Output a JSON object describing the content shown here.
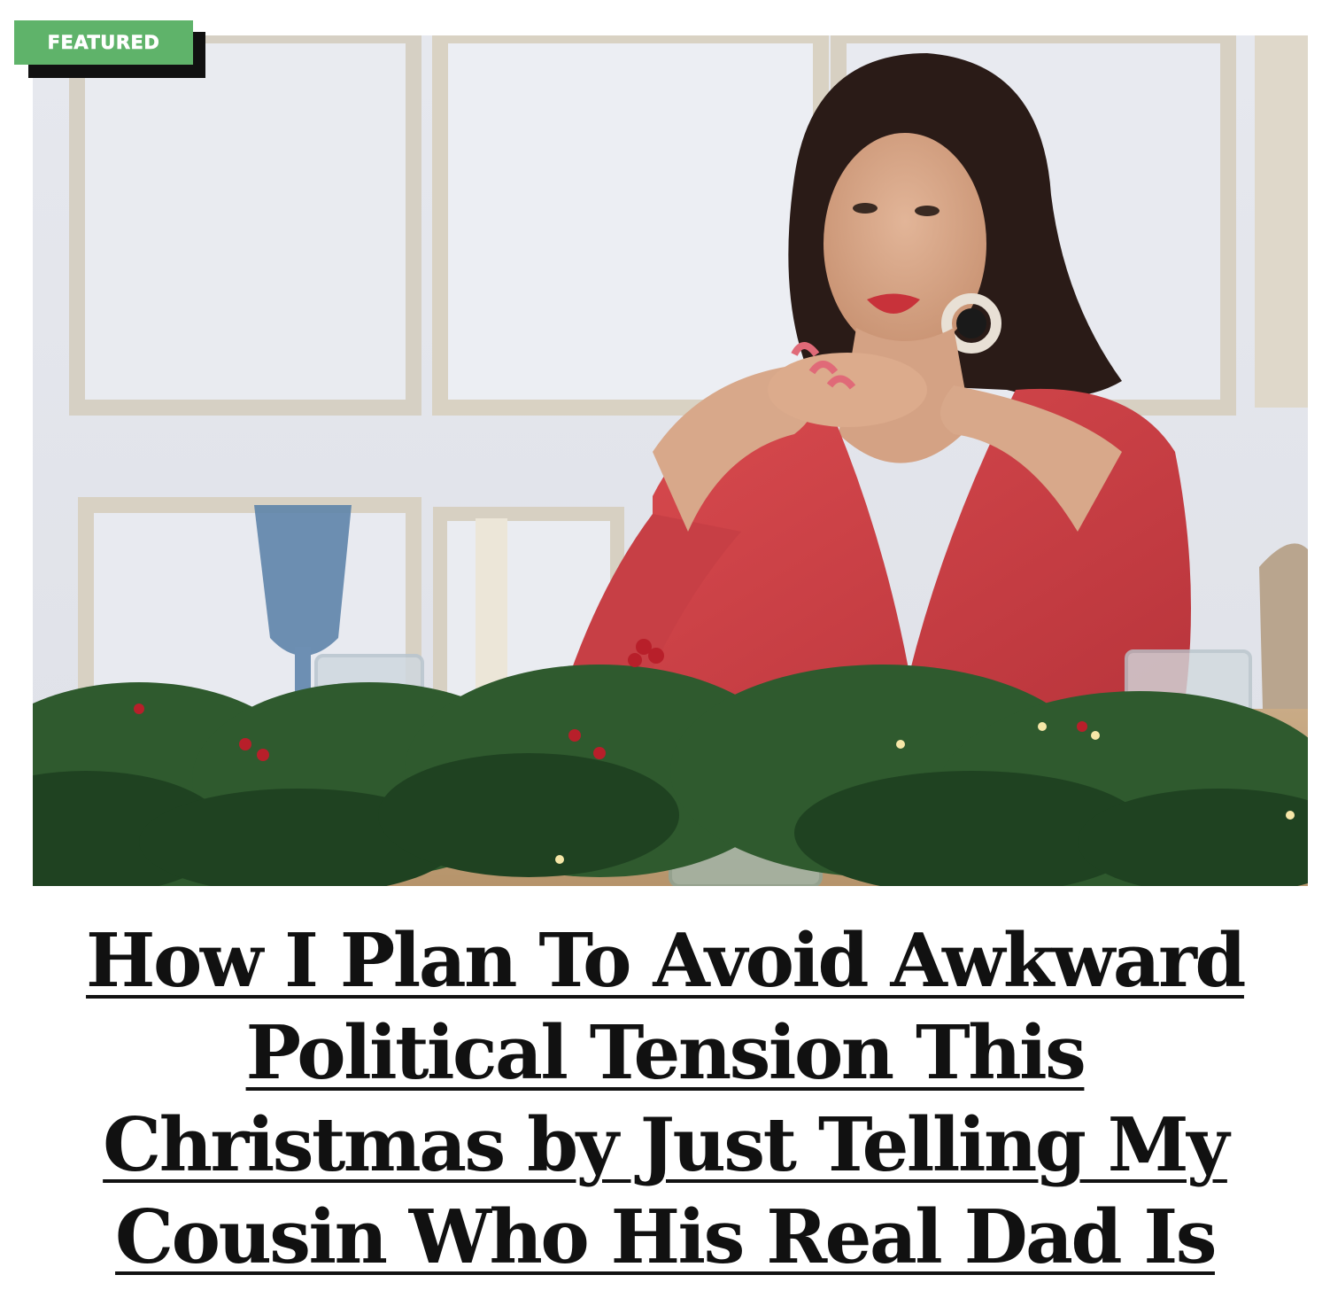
{
  "article": {
    "badge_label": "FEATURED",
    "headline": "How I Plan To Avoid Awkward Political Tension This Christmas by Just Telling My Cousin Who His Real Dad Is",
    "image_alt": "Woman in a red dress sitting at a holiday table with pine garland and glassware"
  },
  "colors": {
    "badge_bg": "#5fb36a",
    "badge_text": "#ffffff",
    "headline": "#111111"
  }
}
